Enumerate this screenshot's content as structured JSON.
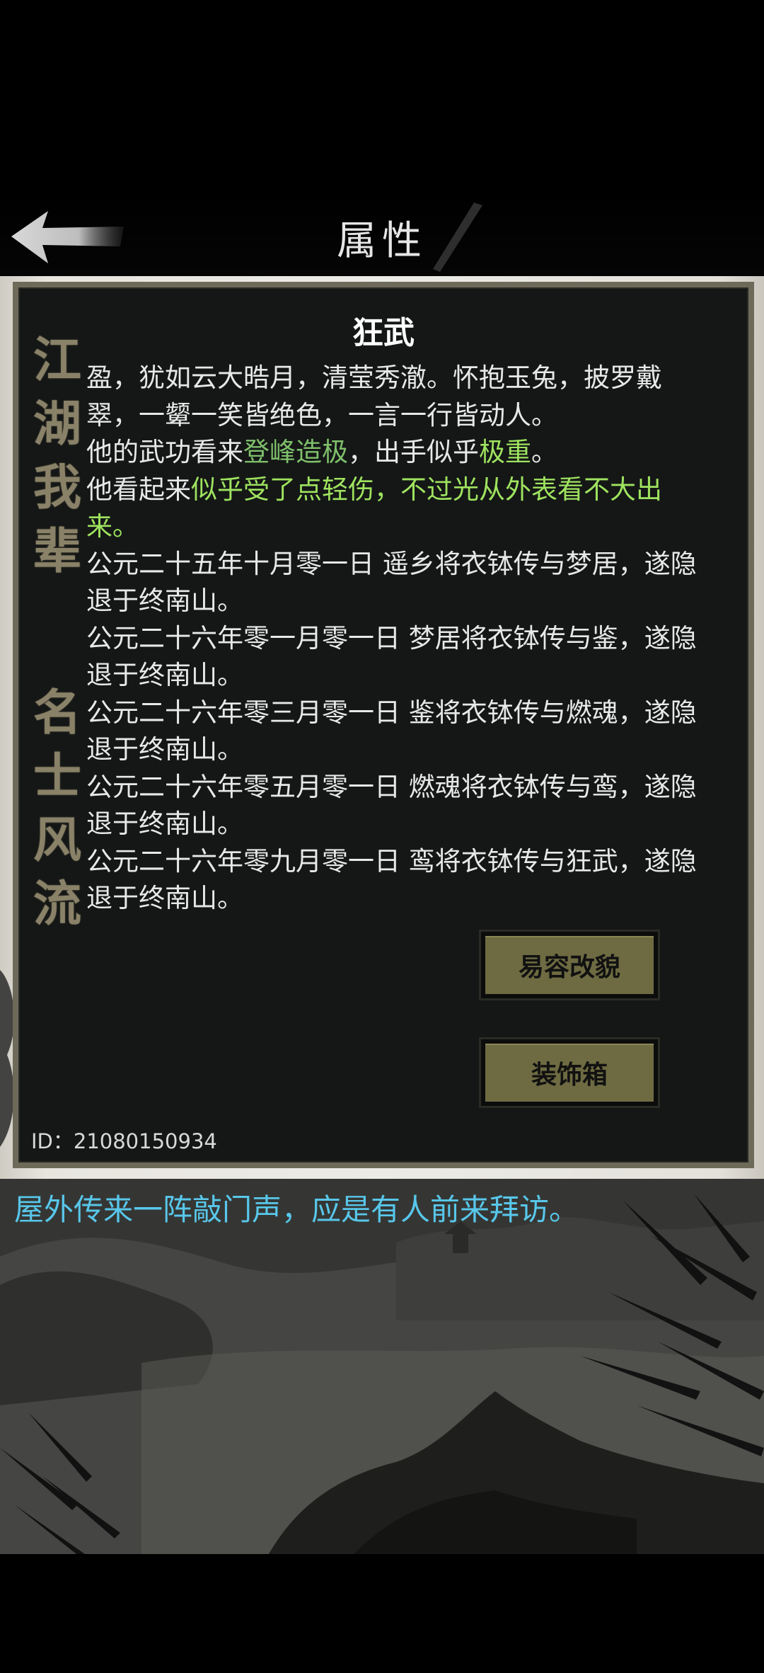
{
  "header": {
    "title": "属性",
    "back_icon": "back-arrow-icon"
  },
  "dialog": {
    "character_name": "狂武",
    "side_text": [
      "江",
      "湖",
      "我",
      "辈",
      "名",
      "士",
      "风",
      "流"
    ],
    "description": [
      {
        "segments": [
          {
            "text": "盈，犹如云大晧月，清莹秀澈。怀抱玉兔，披罗戴翠，一颦一笑皆绝色，一言一行皆动人。",
            "color": "normal"
          }
        ]
      },
      {
        "segments": [
          {
            "text": "他的武功看来",
            "color": "normal"
          },
          {
            "text": "登峰造极",
            "color": "green"
          },
          {
            "text": "，出手似乎",
            "color": "normal"
          },
          {
            "text": "极重",
            "color": "bright"
          },
          {
            "text": "。",
            "color": "normal"
          }
        ]
      },
      {
        "segments": [
          {
            "text": "他看起来",
            "color": "normal"
          },
          {
            "text": "似乎受了点轻伤，不过光从外表看不大出来。",
            "color": "bright"
          }
        ]
      },
      {
        "segments": [
          {
            "text": "公元二十五年十月零一日 遥乡将衣钵传与梦居，遂隐退于终南山。",
            "color": "normal"
          }
        ]
      },
      {
        "segments": [
          {
            "text": "公元二十六年零一月零一日 梦居将衣钵传与鉴，遂隐退于终南山。",
            "color": "normal"
          }
        ]
      },
      {
        "segments": [
          {
            "text": "公元二十六年零三月零一日 鉴将衣钵传与燃魂，遂隐退于终南山。",
            "color": "normal"
          }
        ]
      },
      {
        "segments": [
          {
            "text": "公元二十六年零五月零一日 燃魂将衣钵传与鸾，遂隐退于终南山。",
            "color": "normal"
          }
        ]
      },
      {
        "segments": [
          {
            "text": "公元二十六年零九月零一日 鸾将衣钵传与狂武，遂隐退于终南山。",
            "color": "normal"
          }
        ]
      }
    ],
    "buttons": {
      "disguise": "易容改貌",
      "wardrobe": "装饰箱"
    },
    "id_text": "ID：21080150934"
  },
  "scene": {
    "message": "屋外传来一阵敲门声，应是有人前来拜访。"
  },
  "colors": {
    "highlight_green": "#7fbf6b",
    "highlight_bright": "#9fe35f",
    "message_cyan": "#58c7ea",
    "button_fill": "#6e6b42",
    "frame": "#6e6a59"
  }
}
